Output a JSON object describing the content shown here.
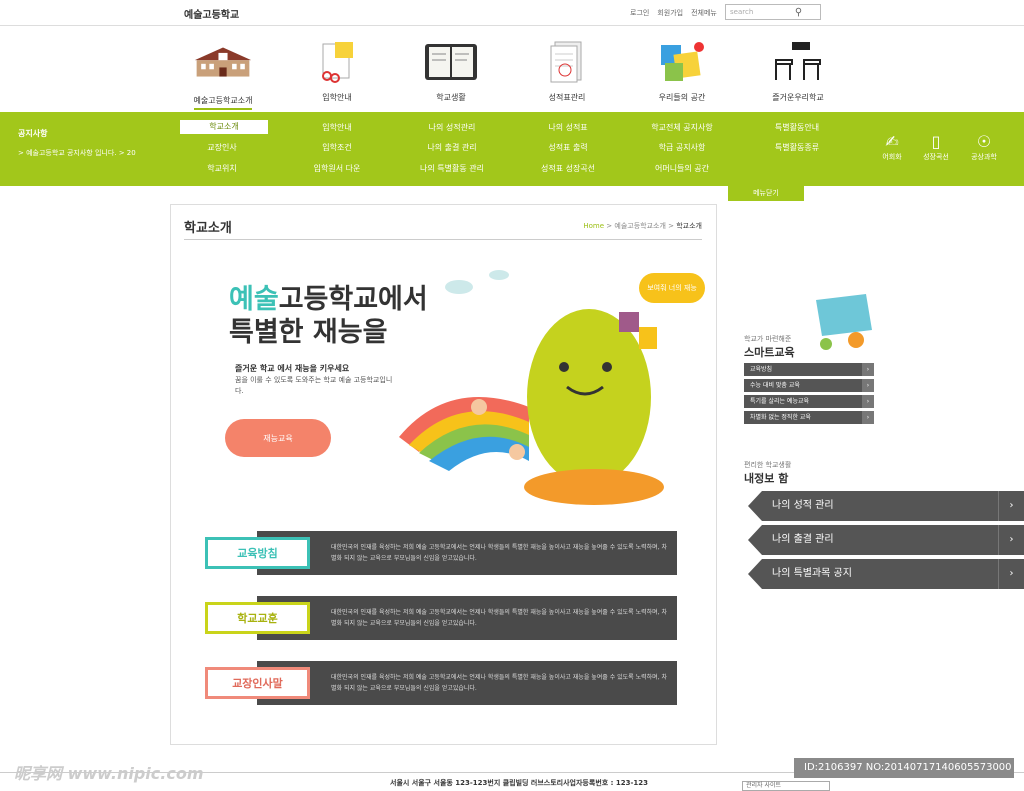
{
  "brand": "예술고등학교",
  "util": [
    "로그인",
    "회원가입",
    "전체메뉴"
  ],
  "search": {
    "placeholder": "search"
  },
  "mainnav": [
    "예술고등학교소개",
    "입학안내",
    "학교생활",
    "성적표관리",
    "우리들의 공간",
    "즐거운우리학교"
  ],
  "notice": {
    "title": "공지사항",
    "text": "> 예술고등학교 공지사항 입니다. > 20"
  },
  "submenu": [
    [
      "학교소개",
      "교장인사",
      "학교위치"
    ],
    [
      "입학안내",
      "입학조건",
      "입학원서 다운"
    ],
    [
      "나의 성적관리",
      "나의 출결 관리",
      "나의 특별활동 관리"
    ],
    [
      "나의 성적표",
      "성적표 출력",
      "성적표 성장곡선"
    ],
    [
      "학교전체 공지사항",
      "학급 공지사항",
      "어머니들의 공간"
    ],
    [
      "특별활동안내",
      "특별활동종류"
    ]
  ],
  "quick": [
    "어회화",
    "성장곡선",
    "공상과학"
  ],
  "close_tab": "메뉴닫기",
  "page": {
    "title": "학교소개",
    "crumb_home": "Home",
    "crumb_mid": "> 예술고등학교소개 >",
    "crumb_cur": "학교소개"
  },
  "hero": {
    "line1a": "예술",
    "line1b": "고등학교에서",
    "line2": "특별한 재능을",
    "sub": "즐거운 학교 에서 재능을 키우세요",
    "desc": "꿈을 이룰 수 있도록 도와주는 학교 예술 고등학교입니다.",
    "button": "재능교육",
    "bubble": "보여줘 너의 재능"
  },
  "rows": [
    {
      "tag": "교육방침",
      "color": "#3cc1b6",
      "text": "대한민국의 인재를 육성하는 저희 예술 고등학교에서는 언제나 학생들의 특별한 재능을 높이사고 재능을 높여줄 수 있도록 노력하며, 차별화 되지 않는 교육으로 부모님들의 신임을 얻고있습니다."
    },
    {
      "tag": "학교교훈",
      "color": "#c9d41a",
      "text": "대한민국의 인재를 육성하는 저희 예술 고등학교에서는 언제나 학생들의 특별한 재능을 높이사고 재능을 높여줄 수 있도록 노력하며, 차별화 되지 않는 교육으로 부모님들의 신임을 얻고있습니다."
    },
    {
      "tag": "교장인사말",
      "color": "#f08a7a",
      "text": "대한민국의 인재를 육성하는 저희 예술 고등학교에서는 언제나 학생들의 특별한 재능을 높이사고 재능을 높여줄 수 있도록 노력하며, 차별화 되지 않는 교육으로 부모님들의 신임을 얻고있습니다."
    }
  ],
  "smart": {
    "sub": "학교가 마련해준",
    "title": "스마트교육",
    "links": [
      "교육방침",
      "수능 대비 맞춤 교육",
      "특기를 살리는 예능교육",
      "차별화 없는 정직한 교육"
    ]
  },
  "info": {
    "sub": "편리한 학교생활",
    "title": "내정보 함",
    "links": [
      "나의 성적 관리",
      "나의 출결 관리",
      "나의 특별과목 공지"
    ]
  },
  "footer": {
    "addr": "서울시 서울구 서울동 123-123번지 클립빌딩 러브스토리사업자등록번호 : 123-123",
    "select": "관리자 사이트"
  },
  "watermark": {
    "left": "昵享网 www.nipic.com",
    "right": "ID:2106397 NO:20140717140605573000"
  }
}
